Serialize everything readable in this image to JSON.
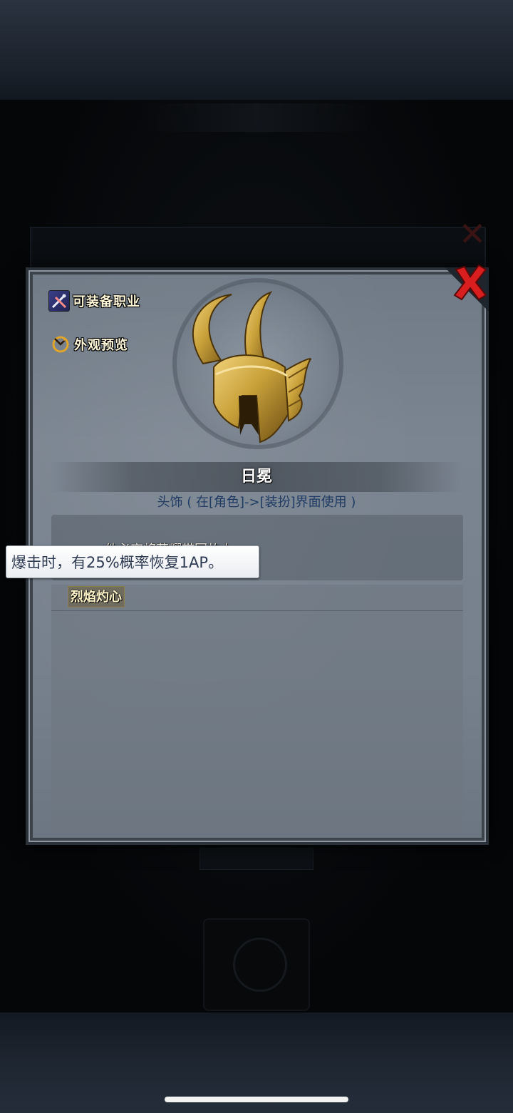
{
  "side_buttons": {
    "equip_classes": "可装备职业",
    "appearance_preview": "外观预览"
  },
  "item": {
    "name": "日冕",
    "type_line": "头饰 ( 在[角色]->[装扮]界面使用 )",
    "description_visible": "...他必定将荣耀带回故土。",
    "skill_name": "烈焰灼心"
  },
  "tooltip": {
    "text": "爆击时，有25%概率恢复1AP。"
  },
  "colors": {
    "close_x": "#d81e1e",
    "helmet_gold": "#c9a13a",
    "type_text": "#1f3b63"
  },
  "icons": {
    "equip_classes": "crossed-weapons-icon",
    "appearance_preview": "refresh-eye-icon",
    "close": "close-icon"
  }
}
